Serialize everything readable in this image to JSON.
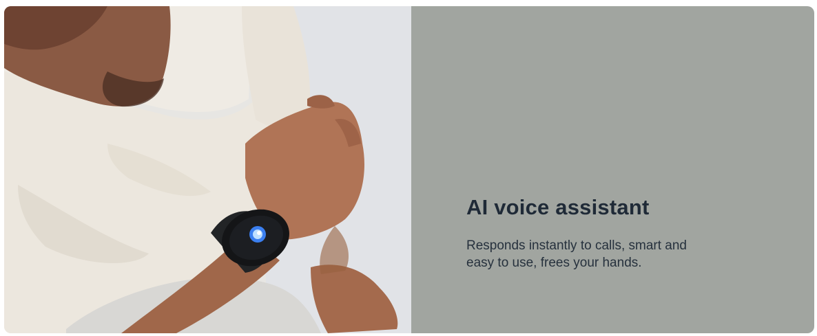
{
  "feature": {
    "title": "AI voice assistant",
    "description": "Responds instantly to calls, smart and easy to use, frees your hands."
  },
  "colors": {
    "panel_background": "#a1a5a0",
    "title_text": "#1f2a37",
    "body_text": "#26313d"
  },
  "photo": {
    "subject": "man-in-white-shirt-wearing-smartwatch",
    "watch_screen_icon": "voice-assistant-orb-icon"
  }
}
